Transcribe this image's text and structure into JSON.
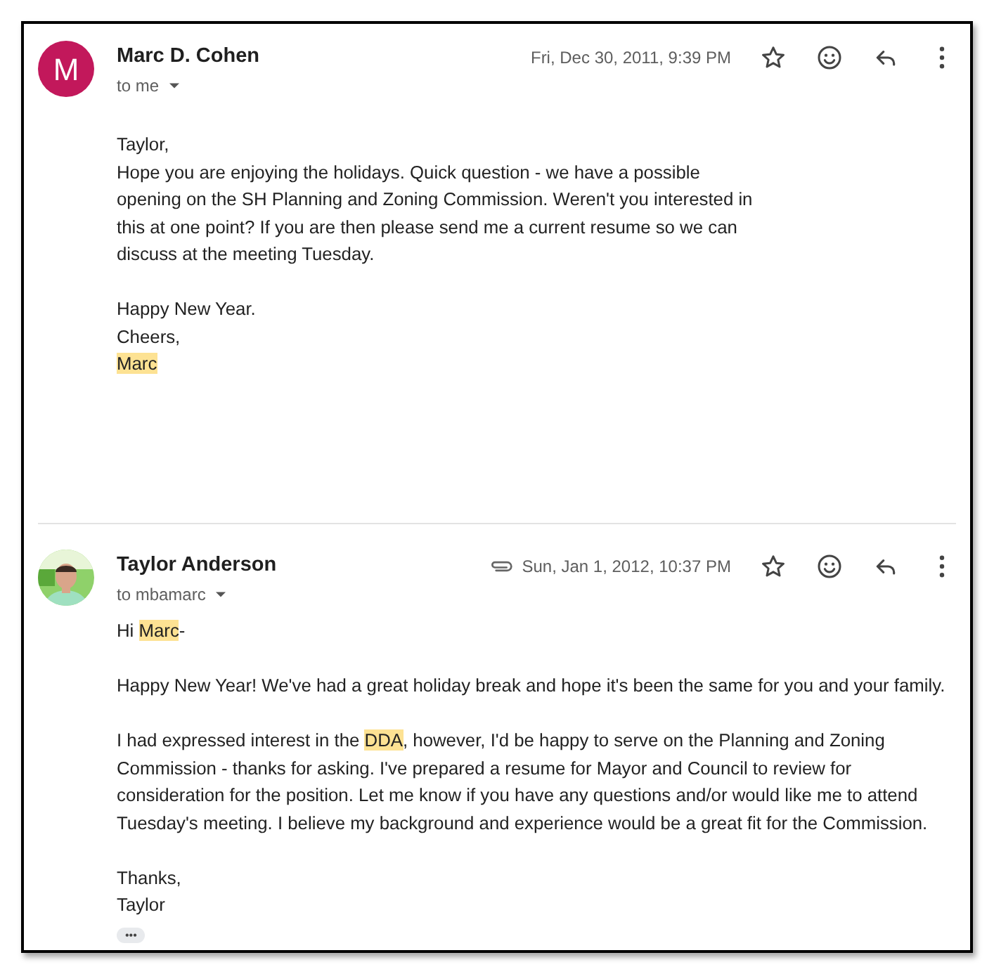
{
  "messages": [
    {
      "sender": "Marc D. Cohen",
      "avatar": {
        "kind": "letter",
        "letter": "M",
        "color": "#c2185b"
      },
      "recipient": "to me",
      "has_attachment": false,
      "date": "Fri, Dec 30, 2011, 9:39 PM",
      "paragraphs": [
        [
          [
            {
              "text": "Taylor,",
              "highlight": false
            }
          ],
          [
            {
              "text": "Hope you are enjoying the holidays. Quick question - we have a possible",
              "highlight": false
            }
          ],
          [
            {
              "text": "opening on the SH Planning and Zoning Commission. Weren't you interested in",
              "highlight": false
            }
          ],
          [
            {
              "text": "this at one point? If you are then please send me a current resume so we can",
              "highlight": false
            }
          ],
          [
            {
              "text": "discuss at the meeting Tuesday.",
              "highlight": false
            }
          ]
        ],
        [
          [
            {
              "text": "Happy New Year.",
              "highlight": false
            }
          ],
          [
            {
              "text": "Cheers,",
              "highlight": false
            }
          ],
          [
            {
              "text": "Marc",
              "highlight": true
            }
          ]
        ]
      ]
    },
    {
      "sender": "Taylor Anderson",
      "avatar": {
        "kind": "picture"
      },
      "recipient": "to mbamarc",
      "has_attachment": true,
      "date": "Sun, Jan 1, 2012, 10:37 PM",
      "trimmed_content_button": "•••",
      "paragraphs": [
        [
          [
            {
              "text": "Hi ",
              "highlight": false
            },
            {
              "text": "Marc",
              "highlight": true
            },
            {
              "text": "-",
              "highlight": false
            }
          ]
        ],
        [
          [
            {
              "text": "Happy New Year! We've had a great holiday break and hope it's been the same for you and your family.",
              "highlight": false
            }
          ]
        ],
        [
          [
            {
              "text": "I had expressed interest in the ",
              "highlight": false
            },
            {
              "text": "DDA",
              "highlight": true
            },
            {
              "text": ", however, I'd be happy to serve on the Planning and Zoning",
              "highlight": false
            }
          ],
          [
            {
              "text": "Commission - thanks for asking. I've prepared a resume for Mayor and Council to review for",
              "highlight": false
            }
          ],
          [
            {
              "text": "consideration for the position. Let me know if you have any questions and/or would like me to attend",
              "highlight": false
            }
          ],
          [
            {
              "text": "Tuesday's meeting. I believe my background and experience would be a great fit for the Commission.",
              "highlight": false
            }
          ]
        ],
        [
          [
            {
              "text": "Thanks,",
              "highlight": false
            }
          ],
          [
            {
              "text": "Taylor",
              "highlight": false
            }
          ]
        ]
      ]
    }
  ]
}
